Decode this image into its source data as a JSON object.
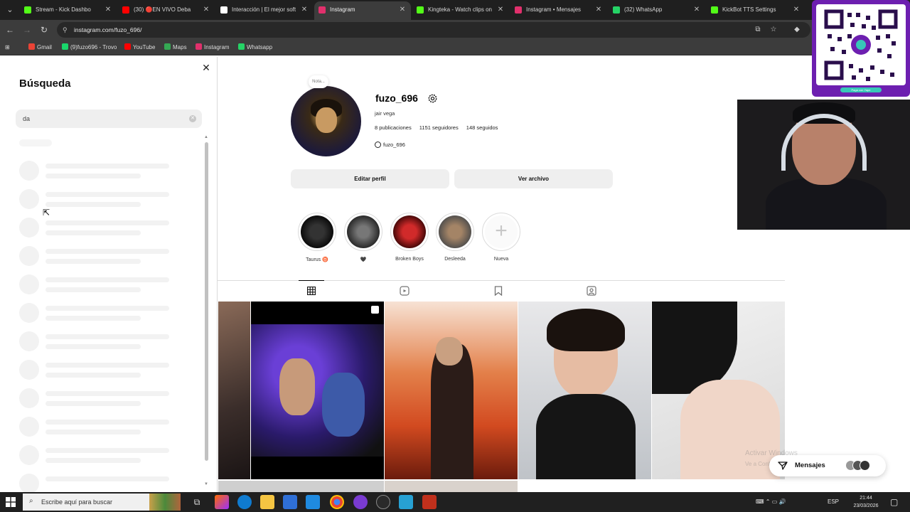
{
  "browser": {
    "tabs": [
      {
        "title": "Stream - Kick Dashbo",
        "color": "#53fc18"
      },
      {
        "title": "(30) 🔴EN VIVO Deba",
        "color": "#ff0000"
      },
      {
        "title": "Interacción | El mejor soft",
        "color": "#ffffff"
      },
      {
        "title": "Instagram",
        "color": "#e1306c"
      },
      {
        "title": "Kingteka - Watch clips on",
        "color": "#53fc18"
      },
      {
        "title": "Instagram • Mensajes",
        "color": "#e1306c"
      },
      {
        "title": "(32) WhatsApp",
        "color": "#25d366"
      },
      {
        "title": "KickBot TTS Settings",
        "color": "#53fc18"
      }
    ],
    "url": "instagram.com/fuzo_696/",
    "bookmarks": [
      {
        "label": "Gmail",
        "color": "#ea4335"
      },
      {
        "label": "(9)fuzo696 - Trovo",
        "color": "#19d66b"
      },
      {
        "label": "YouTube",
        "color": "#ff0000"
      },
      {
        "label": "Maps",
        "color": "#34a853"
      },
      {
        "label": "Instagram",
        "color": "#e1306c"
      },
      {
        "label": "Whatsapp",
        "color": "#25d366"
      }
    ]
  },
  "search": {
    "title": "Búsqueda",
    "value": "da"
  },
  "profile": {
    "note": "Nota...",
    "username": "fuzo_696",
    "full_name": "jair vega",
    "posts": "8 publicaciones",
    "followers": "1151 seguidores",
    "following": "148 seguidos",
    "threads": "fuzo_696",
    "edit_button": "Editar perfil",
    "archive_button": "Ver archivo"
  },
  "highlights": [
    {
      "label": "Taurus ♉"
    },
    {
      "label": "🖤"
    },
    {
      "label": "Broken Boys"
    },
    {
      "label": "Desleeda"
    },
    {
      "label": "Nueva"
    }
  ],
  "messages": {
    "label": "Mensajes"
  },
  "watermark": {
    "line1": "Activar Windows",
    "line2": "Ve a Configuración para activar Windows."
  },
  "taskbar": {
    "search_placeholder": "Escribe aquí para buscar",
    "lang": "ESP",
    "time": "21:44",
    "date": "23/03/2026"
  },
  "qr": {
    "footer": "Paga con Yape"
  },
  "colors": {
    "accent": "#0095f6",
    "brand": "#e1306c",
    "qr_card": "#6d1fb0"
  }
}
